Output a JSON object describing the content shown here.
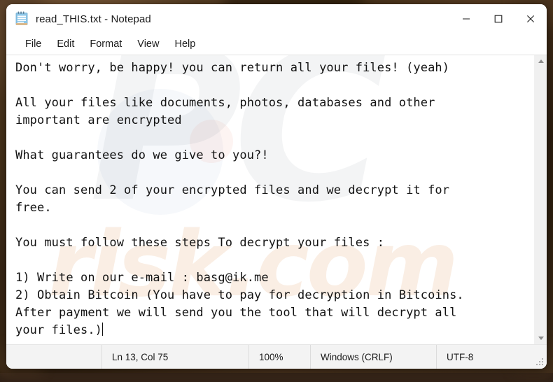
{
  "window": {
    "title": "read_THIS.txt - Notepad",
    "app_icon": "notepad-icon",
    "controls": {
      "minimize": "—",
      "maximize": "☐",
      "close": "✕"
    }
  },
  "menubar": {
    "items": [
      {
        "label": "File"
      },
      {
        "label": "Edit"
      },
      {
        "label": "Format"
      },
      {
        "label": "View"
      },
      {
        "label": "Help"
      }
    ]
  },
  "editor": {
    "content": "Don't worry, be happy! you can return all your files! (yeah)\n\nAll your files like documents, photos, databases and other\nimportant are encrypted\n\nWhat guarantees do we give to you?!\n\nYou can send 2 of your encrypted files and we decrypt it for\nfree.\n\nYou must follow these steps To decrypt your files :\n\n1) Write on our e-mail : basg@ik.me\n2) Obtain Bitcoin (You have to pay for decryption in Bitcoins.\nAfter payment we will send you the tool that will decrypt all\nyour files.)",
    "email": "basg@ik.me",
    "watermark_primary": "PC",
    "watermark_secondary": "risk.com"
  },
  "statusbar": {
    "position": "Ln 13, Col 75",
    "zoom": "100%",
    "line_ending": "Windows (CRLF)",
    "encoding": "UTF-8"
  },
  "colors": {
    "window_bg": "#ffffff",
    "statusbar_bg": "#f3f3f3",
    "text": "#131313",
    "desktop": "#2a1d14",
    "close_hover": "#e81123"
  }
}
